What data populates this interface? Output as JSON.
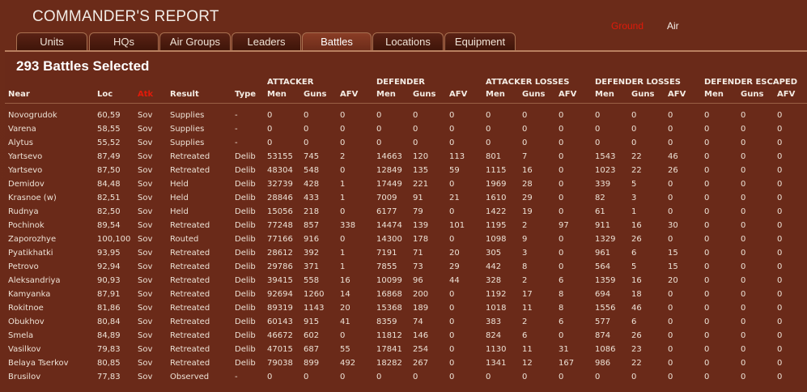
{
  "title": "COMMANDER'S REPORT",
  "toggles": {
    "ground": "Ground",
    "air": "Air",
    "colors": {
      "active": "#e11a0a",
      "inactive": "#f4eee8"
    }
  },
  "tabs": [
    "Units",
    "HQs",
    "Air Groups",
    "Leaders",
    "Battles",
    "Locations",
    "Equipment"
  ],
  "active_tab": "Battles",
  "subtitle": "293 Battles Selected",
  "group_headers": [
    "ATTACKER",
    "DEFENDER",
    "ATTACKER LOSSES",
    "DEFENDER LOSSES",
    "DEFENDER ESCAPED"
  ],
  "columns": [
    "Near",
    "Loc",
    "Atk",
    "Result",
    "Type",
    "Men",
    "Guns",
    "AFV",
    "Men",
    "Guns",
    "AFV",
    "Men",
    "Guns",
    "AFV",
    "Men",
    "Guns",
    "AFV",
    "Men",
    "Guns",
    "AFV"
  ],
  "rows": [
    [
      "Novogrudok",
      "60,59",
      "Sov",
      "Supplies",
      "-",
      "0",
      "0",
      "0",
      "0",
      "0",
      "0",
      "0",
      "0",
      "0",
      "0",
      "0",
      "0",
      "0",
      "0",
      "0"
    ],
    [
      "Varena",
      "58,55",
      "Sov",
      "Supplies",
      "-",
      "0",
      "0",
      "0",
      "0",
      "0",
      "0",
      "0",
      "0",
      "0",
      "0",
      "0",
      "0",
      "0",
      "0",
      "0"
    ],
    [
      "Alytus",
      "55,52",
      "Sov",
      "Supplies",
      "-",
      "0",
      "0",
      "0",
      "0",
      "0",
      "0",
      "0",
      "0",
      "0",
      "0",
      "0",
      "0",
      "0",
      "0",
      "0"
    ],
    [
      "Yartsevo",
      "87,49",
      "Sov",
      "Retreated",
      "Delib",
      "53155",
      "745",
      "2",
      "14663",
      "120",
      "113",
      "801",
      "7",
      "0",
      "1543",
      "22",
      "46",
      "0",
      "0",
      "0"
    ],
    [
      "Yartsevo",
      "87,50",
      "Sov",
      "Retreated",
      "Delib",
      "48304",
      "548",
      "0",
      "12849",
      "135",
      "59",
      "1115",
      "16",
      "0",
      "1023",
      "22",
      "26",
      "0",
      "0",
      "0"
    ],
    [
      "Demidov",
      "84,48",
      "Sov",
      "Held",
      "Delib",
      "32739",
      "428",
      "1",
      "17449",
      "221",
      "0",
      "1969",
      "28",
      "0",
      "339",
      "5",
      "0",
      "0",
      "0",
      "0"
    ],
    [
      "Krasnoe (w)",
      "82,51",
      "Sov",
      "Held",
      "Delib",
      "28846",
      "433",
      "1",
      "7009",
      "91",
      "21",
      "1610",
      "29",
      "0",
      "82",
      "3",
      "0",
      "0",
      "0",
      "0"
    ],
    [
      "Rudnya",
      "82,50",
      "Sov",
      "Held",
      "Delib",
      "15056",
      "218",
      "0",
      "6177",
      "79",
      "0",
      "1422",
      "19",
      "0",
      "61",
      "1",
      "0",
      "0",
      "0",
      "0"
    ],
    [
      "Pochinok",
      "89,54",
      "Sov",
      "Retreated",
      "Delib",
      "77248",
      "857",
      "338",
      "14474",
      "139",
      "101",
      "1195",
      "2",
      "97",
      "911",
      "16",
      "30",
      "0",
      "0",
      "0"
    ],
    [
      "Zaporozhye",
      "100,100",
      "Sov",
      "Routed",
      "Delib",
      "77166",
      "916",
      "0",
      "14300",
      "178",
      "0",
      "1098",
      "9",
      "0",
      "1329",
      "26",
      "0",
      "0",
      "0",
      "0"
    ],
    [
      "Pyatikhatki",
      "93,95",
      "Sov",
      "Retreated",
      "Delib",
      "28612",
      "392",
      "1",
      "7191",
      "71",
      "20",
      "305",
      "3",
      "0",
      "961",
      "6",
      "15",
      "0",
      "0",
      "0"
    ],
    [
      "Petrovo",
      "92,94",
      "Sov",
      "Retreated",
      "Delib",
      "29786",
      "371",
      "1",
      "7855",
      "73",
      "29",
      "442",
      "8",
      "0",
      "564",
      "5",
      "15",
      "0",
      "0",
      "0"
    ],
    [
      "Aleksandriya",
      "90,93",
      "Sov",
      "Retreated",
      "Delib",
      "39415",
      "558",
      "16",
      "10099",
      "96",
      "44",
      "328",
      "2",
      "6",
      "1359",
      "16",
      "20",
      "0",
      "0",
      "0"
    ],
    [
      "Kamyanka",
      "87,91",
      "Sov",
      "Retreated",
      "Delib",
      "92694",
      "1260",
      "14",
      "16868",
      "200",
      "0",
      "1192",
      "17",
      "8",
      "694",
      "18",
      "0",
      "0",
      "0",
      "0"
    ],
    [
      "Rokitnoe",
      "81,86",
      "Sov",
      "Retreated",
      "Delib",
      "89319",
      "1143",
      "20",
      "15368",
      "189",
      "0",
      "1018",
      "11",
      "8",
      "1556",
      "46",
      "0",
      "0",
      "0",
      "0"
    ],
    [
      "Obukhov",
      "80,84",
      "Sov",
      "Retreated",
      "Delib",
      "60143",
      "915",
      "41",
      "8359",
      "74",
      "0",
      "383",
      "2",
      "6",
      "577",
      "6",
      "0",
      "0",
      "0",
      "0"
    ],
    [
      "Smela",
      "84,89",
      "Sov",
      "Retreated",
      "Delib",
      "46672",
      "602",
      "0",
      "11812",
      "146",
      "0",
      "824",
      "6",
      "0",
      "874",
      "26",
      "0",
      "0",
      "0",
      "0"
    ],
    [
      "Vasilkov",
      "79,83",
      "Sov",
      "Retreated",
      "Delib",
      "47015",
      "687",
      "55",
      "17841",
      "254",
      "0",
      "1130",
      "11",
      "31",
      "1086",
      "23",
      "0",
      "0",
      "0",
      "0"
    ],
    [
      "Belaya Tserkov",
      "80,85",
      "Sov",
      "Retreated",
      "Delib",
      "79038",
      "899",
      "492",
      "18282",
      "267",
      "0",
      "1341",
      "12",
      "167",
      "986",
      "22",
      "0",
      "0",
      "0",
      "0"
    ],
    [
      "Brusilov",
      "77,83",
      "Sov",
      "Observed",
      "-",
      "0",
      "0",
      "0",
      "0",
      "0",
      "0",
      "0",
      "0",
      "0",
      "0",
      "0",
      "0",
      "0",
      "0",
      "0"
    ]
  ]
}
